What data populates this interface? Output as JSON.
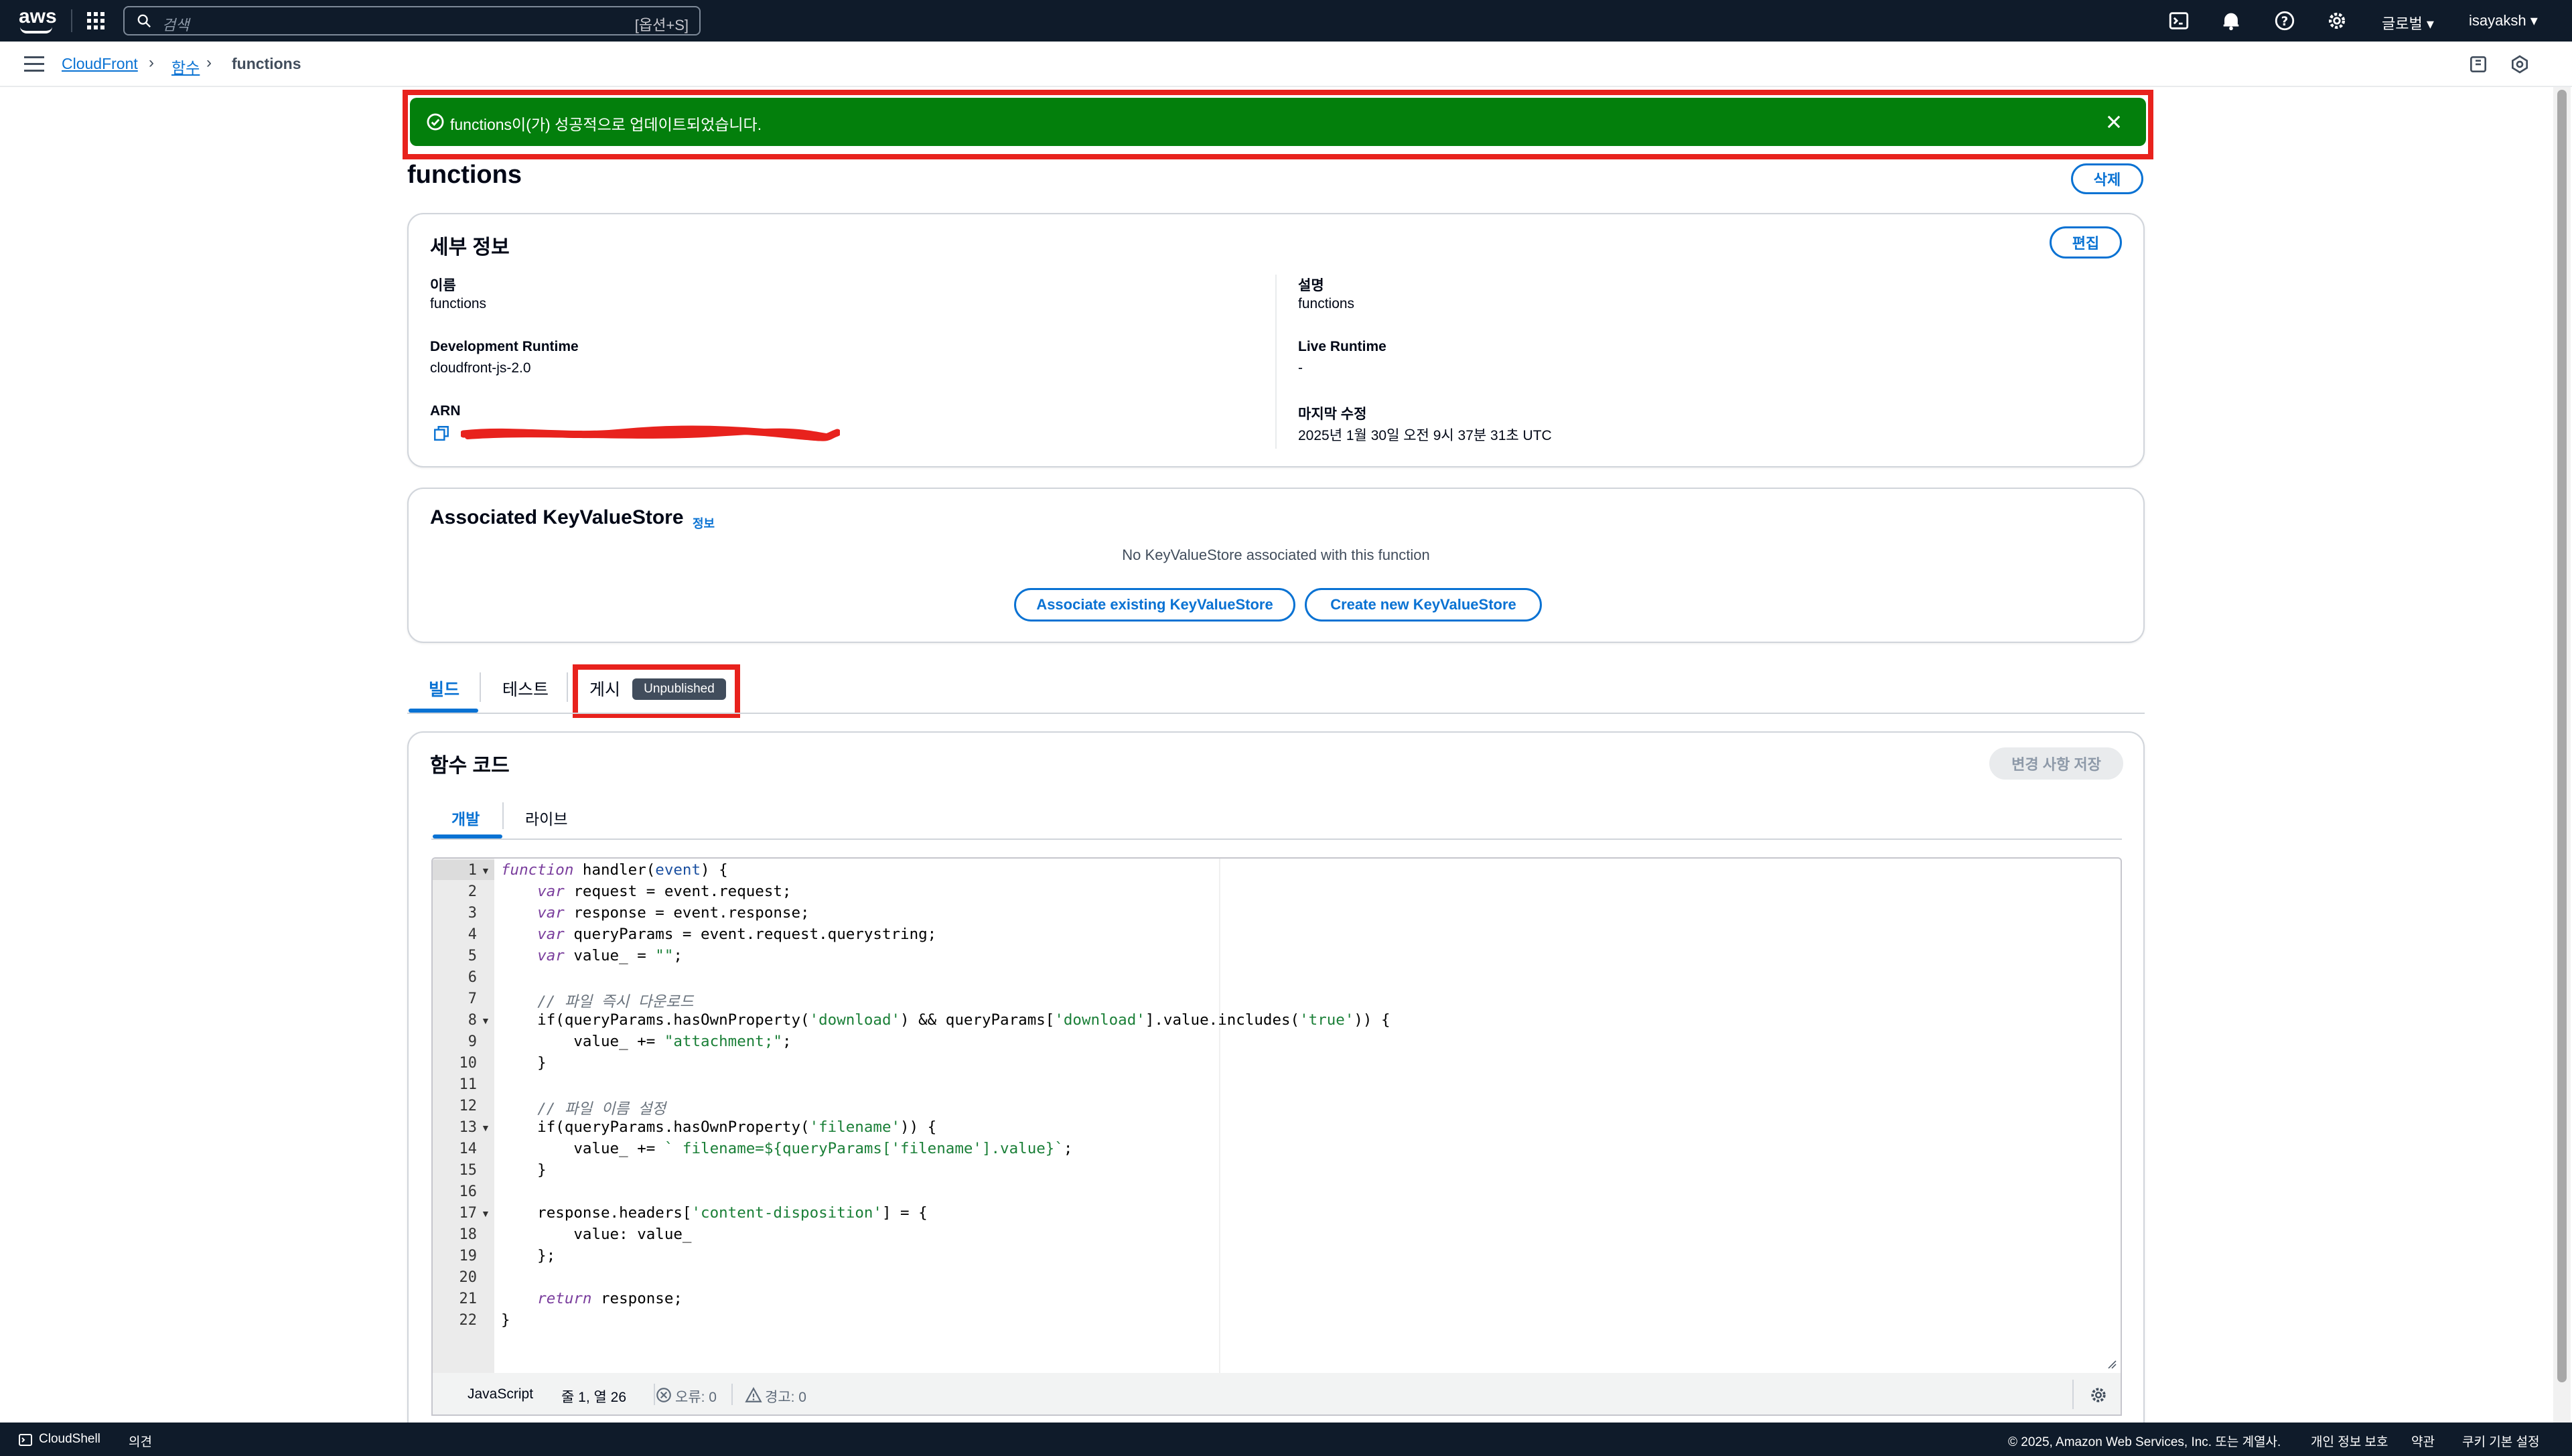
{
  "nav": {
    "logo": "aws",
    "search_placeholder": "검색",
    "search_shortcut": "[옵션+S]",
    "region": "글로벌 ▾",
    "user": "isayaksh ▾"
  },
  "breadcrumb": {
    "items": [
      "CloudFront",
      "함수"
    ],
    "current": "functions"
  },
  "flash": {
    "message": "functions이(가) 성공적으로 업데이트되었습니다.",
    "type": "success"
  },
  "page": {
    "title": "functions",
    "delete_label": "삭제"
  },
  "details": {
    "title": "세부 정보",
    "edit_label": "편집",
    "name_label": "이름",
    "name_value": "functions",
    "dev_runtime_label": "Development Runtime",
    "dev_runtime_value": "cloudfront-js-2.0",
    "arn_label": "ARN",
    "desc_label": "설명",
    "desc_value": "functions",
    "live_runtime_label": "Live Runtime",
    "live_runtime_value": "-",
    "modified_label": "마지막 수정",
    "modified_value": "2025년 1월 30일 오전 9시 37분 31초 UTC"
  },
  "kvs": {
    "title": "Associated KeyValueStore",
    "info_label": "정보",
    "empty_text": "No KeyValueStore associated with this function",
    "associate_label": "Associate existing KeyValueStore",
    "create_label": "Create new KeyValueStore"
  },
  "tabs": {
    "items": [
      "빌드",
      "테스트",
      "게시"
    ],
    "active_index": 0,
    "badge": "Unpublished"
  },
  "code_panel": {
    "title": "함수 코드",
    "save_label": "변경 사항 저장",
    "subtabs": [
      "개발",
      "라이브"
    ],
    "active_subtab": 0
  },
  "editor": {
    "lines": [
      "function handler(event) {",
      "    var request = event.request;",
      "    var response = event.response;",
      "    var queryParams = event.request.querystring;",
      "    var value_ = \"\";",
      "",
      "    // 파일 즉시 다운로드",
      "    if(queryParams.hasOwnProperty('download') && queryParams['download'].value.includes('true')) {",
      "        value_ += \"attachment;\";",
      "    }",
      "",
      "    // 파일 이름 설정",
      "    if(queryParams.hasOwnProperty('filename')) {",
      "        value_ += ` filename=${queryParams['filename'].value}`;",
      "    }",
      "",
      "    response.headers['content-disposition'] = {",
      "        value: value_",
      "    };",
      "",
      "    return response;",
      "}"
    ],
    "fold_lines": [
      1,
      8,
      13,
      17
    ]
  },
  "status": {
    "language": "JavaScript",
    "position": "줄 1, 열 26",
    "errors": "오류: 0",
    "warnings": "경고: 0"
  },
  "footer": {
    "cloudshell": "CloudShell",
    "feedback": "의견",
    "copyright": "© 2025, Amazon Web Services, Inc. 또는 계열사.",
    "privacy": "개인 정보 보호",
    "terms": "약관",
    "cookies": "쿠키 기본 설정"
  },
  "colors": {
    "nav_bg": "#0f1b2a",
    "accent": "#0972d3",
    "success": "#037f0c",
    "highlight": "#e8221d"
  }
}
